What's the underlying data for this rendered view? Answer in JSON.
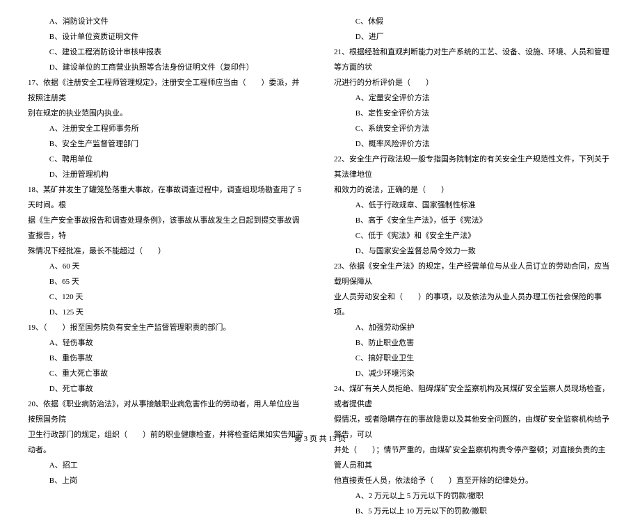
{
  "left": {
    "q16_opts": [
      "A、消防设计文件",
      "B、设计单位资质证明文件",
      "C、建设工程消防设计审核申报表",
      "D、建设单位的工商营业执照等合法身份证明文件（复印件）"
    ],
    "q17_l1": "17、依据《注册安全工程师管理规定》，注册安全工程师应当由（　　）委派，并按照注册类",
    "q17_l2": "别在规定的执业范围内执业。",
    "q17_opts": [
      "A、注册安全工程师事务所",
      "B、安全生产监督管理部门",
      "C、聘用单位",
      "D、注册管理机构"
    ],
    "q18_l1": "18、某矿井发生了罐笼坠落重大事故，在事故调查过程中，调查组现场勘查用了 5 天时间。根",
    "q18_l2": "据《生产安全事故报告和调查处理条例》，该事故从事故发生之日起到提交事故调查报告，特",
    "q18_l3": "殊情况下经批准，最长不能超过（　　）",
    "q18_opts": [
      "A、60 天",
      "B、65 天",
      "C、120 天",
      "D、125 天"
    ],
    "q19_l1": "19、（　　）报至国务院负有安全生产监督管理职责的部门。",
    "q19_opts": [
      "A、轻伤事故",
      "B、重伤事故",
      "C、重大死亡事故",
      "D、死亡事故"
    ],
    "q20_l1": "20、依据《职业病防治法》，对从事接触职业病危害作业的劳动者，用人单位应当按照国务院",
    "q20_l2": "卫生行政部门的规定，组织（　　）前的职业健康检查，并将检查结果如实告知劳动者。",
    "q20_opts": [
      "A、招工",
      "B、上岗"
    ]
  },
  "right": {
    "q20_opts": [
      "C、休假",
      "D、进厂"
    ],
    "q21_l1": "21、根据经验和直观判断能力对生产系统的工艺、设备、设施、环境、人员和管理等方面的状",
    "q21_l2": "况进行的分析评价是（　　）",
    "q21_opts": [
      "A、定量安全评价方法",
      "B、定性安全评价方法",
      "C、系统安全评价方法",
      "D、概率风险评价方法"
    ],
    "q22_l1": "22、安全生产行政法规一般专指国务院制定的有关安全生产规范性文件，下列关于其法律地位",
    "q22_l2": "和效力的说法，正确的是（　　）",
    "q22_opts": [
      "A、低于行政规章、国家强制性标准",
      "B、高于《安全生产法》，低于《宪法》",
      "C、低于《宪法》和《安全生产法》",
      "D、与国家安全监督总局令效力一致"
    ],
    "q23_l1": "23、依据《安全生产法》的规定，生产经营单位与从业人员订立的劳动合同，应当载明保障从",
    "q23_l2": "业人员劳动安全和（　　）的事项，以及依法为从业人员办理工伤社会保险的事项。",
    "q23_opts": [
      "A、加强劳动保护",
      "B、防止职业危害",
      "C、搞好职业卫生",
      "D、减少环境污染"
    ],
    "q24_l1": "24、煤矿有关人员拒绝、阻碍煤矿安全监察机构及其煤矿安全监察人员现场检查，或者提供虚",
    "q24_l2": "假情况，或者隐瞒存在的事故隐患以及其他安全问题的，由煤矿安全监察机构给予警告，可以",
    "q24_l3": "并处（　　）；情节严重的，由煤矿安全监察机构责令停产整顿；对直接负责的主管人员和其",
    "q24_l4": "他直接责任人员，依法给予（　　）直至开除的纪律处分。",
    "q24_opts": [
      "A、2 万元以上 5 万元以下的罚款/撤职",
      "B、5 万元以上 10 万元以下的罚款/撤职"
    ]
  },
  "footer": "第 3 页 共 13 页"
}
